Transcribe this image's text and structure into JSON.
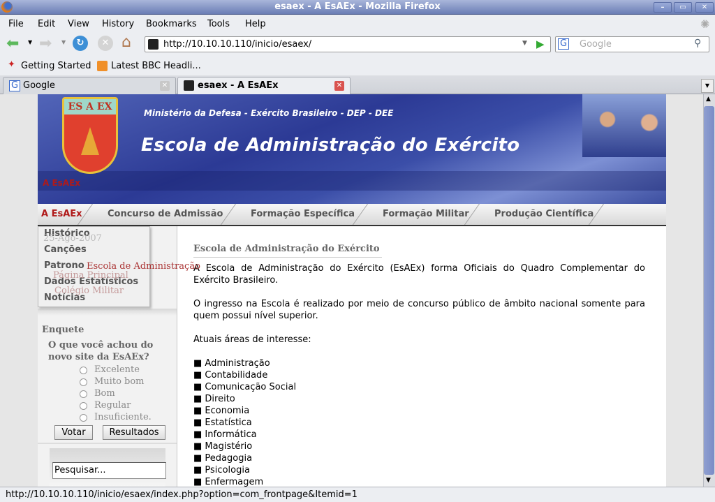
{
  "window": {
    "title": "esaex - A EsAEx - Mozilla Firefox"
  },
  "menu": [
    "File",
    "Edit",
    "View",
    "History",
    "Bookmarks",
    "Tools",
    "Help"
  ],
  "toolbar": {
    "url": "http://10.10.10.110/inicio/esaex/",
    "search_placeholder": "Google"
  },
  "bookmarks": [
    "Getting Started",
    "Latest BBC Headli..."
  ],
  "tabs": [
    {
      "label": "Google",
      "active": false
    },
    {
      "label": "esaex - A EsAEx",
      "active": true
    }
  ],
  "site": {
    "logo_text": "ES A EX",
    "ministry": "Ministério da Defesa - Exército Brasileiro - DEP - DEE",
    "title": "Escola de Administração do Exército",
    "breadcrumb": "A EsAEx",
    "nav": [
      "A EsAEx",
      "Concurso de Admissão",
      "Formação Específica",
      "Formação Militar",
      "Produção Científica"
    ],
    "dropdown": [
      "Histórico",
      "Canções",
      "Patrono",
      "Dados Estatísticos",
      "Notícias"
    ],
    "hidden_behind": {
      "date": "25-Ago-2007",
      "links": [
        "Escola de Administração",
        "Página Principal",
        "Colégio Militar"
      ]
    },
    "poll": {
      "title": "Enquete",
      "question": "O que você achou do novo site da EsAEx?",
      "options": [
        "Excelente",
        "Muito bom",
        "Bom",
        "Regular",
        "Insuficiente."
      ],
      "vote": "Votar",
      "results": "Resultados"
    },
    "search_value": "Pesquisar...",
    "article": {
      "heading": "Escola de Administração do Exército",
      "p1": "A Escola de Administração do Exército (EsAEx) forma Oficiais do Quadro Complementar do Exército Brasileiro.",
      "p2": "O ingresso na Escola é realizado por meio de concurso público de âmbito nacional somente para quem possui nível superior.",
      "p3": "Atuais áreas de interesse:",
      "areas": [
        "Administração",
        "Contabilidade",
        "Comunicação Social",
        "Direito",
        "Economia",
        "Estatística",
        "Informática",
        "Magistério",
        "Pedagogia",
        "Psicologia",
        "Enfermagem"
      ]
    }
  },
  "status": "http://10.10.10.110/inicio/esaex/index.php?option=com_frontpage&Itemid=1",
  "colors": {
    "titlebar": "#6a7db5",
    "banner": "#2c3a95",
    "accent_red": "#b01a1a"
  }
}
